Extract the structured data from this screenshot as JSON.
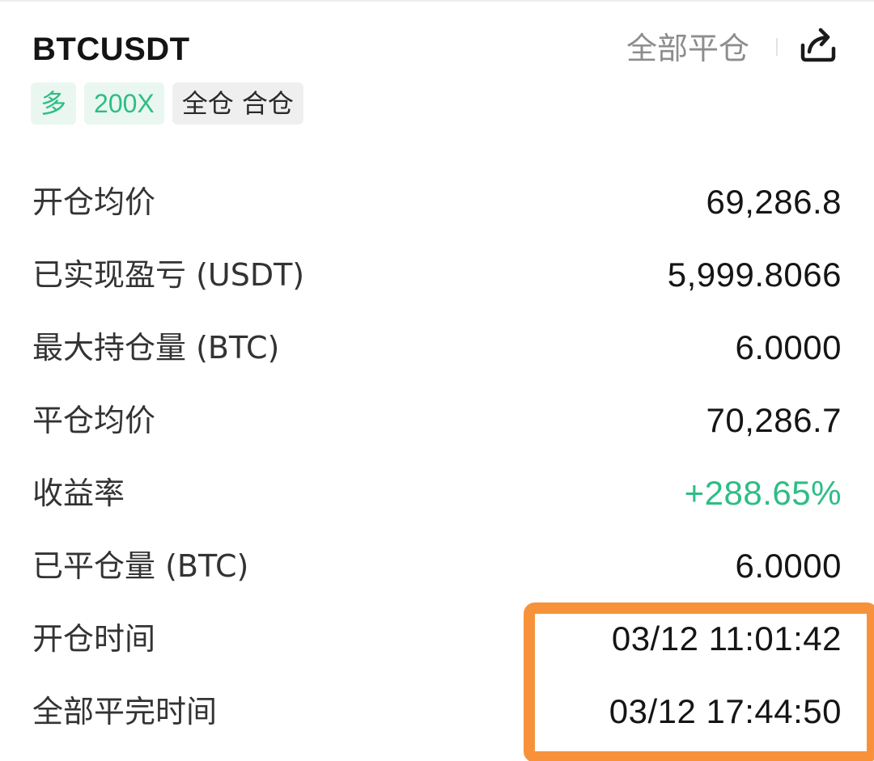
{
  "header": {
    "symbol": "BTCUSDT",
    "close_all_label": "全部平仓",
    "share_icon": "share-icon"
  },
  "tags": [
    {
      "label": "多"
    },
    {
      "label": "200X"
    },
    {
      "label": "全仓 合仓"
    }
  ],
  "details": [
    {
      "label": "开仓均价",
      "value": "69,286.8"
    },
    {
      "label": "已实现盈亏 (USDT)",
      "value": "5,999.8066"
    },
    {
      "label": "最大持仓量 (BTC)",
      "value": "6.0000"
    },
    {
      "label": "平仓均价",
      "value": "70,286.7"
    },
    {
      "label": "收益率",
      "value": "+288.65%"
    },
    {
      "label": "已平仓量 (BTC)",
      "value": "6.0000"
    },
    {
      "label": "开仓时间",
      "value": "03/12 11:01:42"
    },
    {
      "label": "全部平完时间",
      "value": "03/12 17:44:50"
    }
  ],
  "colors": {
    "positive": "#2ebd85",
    "highlight": "#f7923a",
    "muted": "#8d8d8d"
  }
}
